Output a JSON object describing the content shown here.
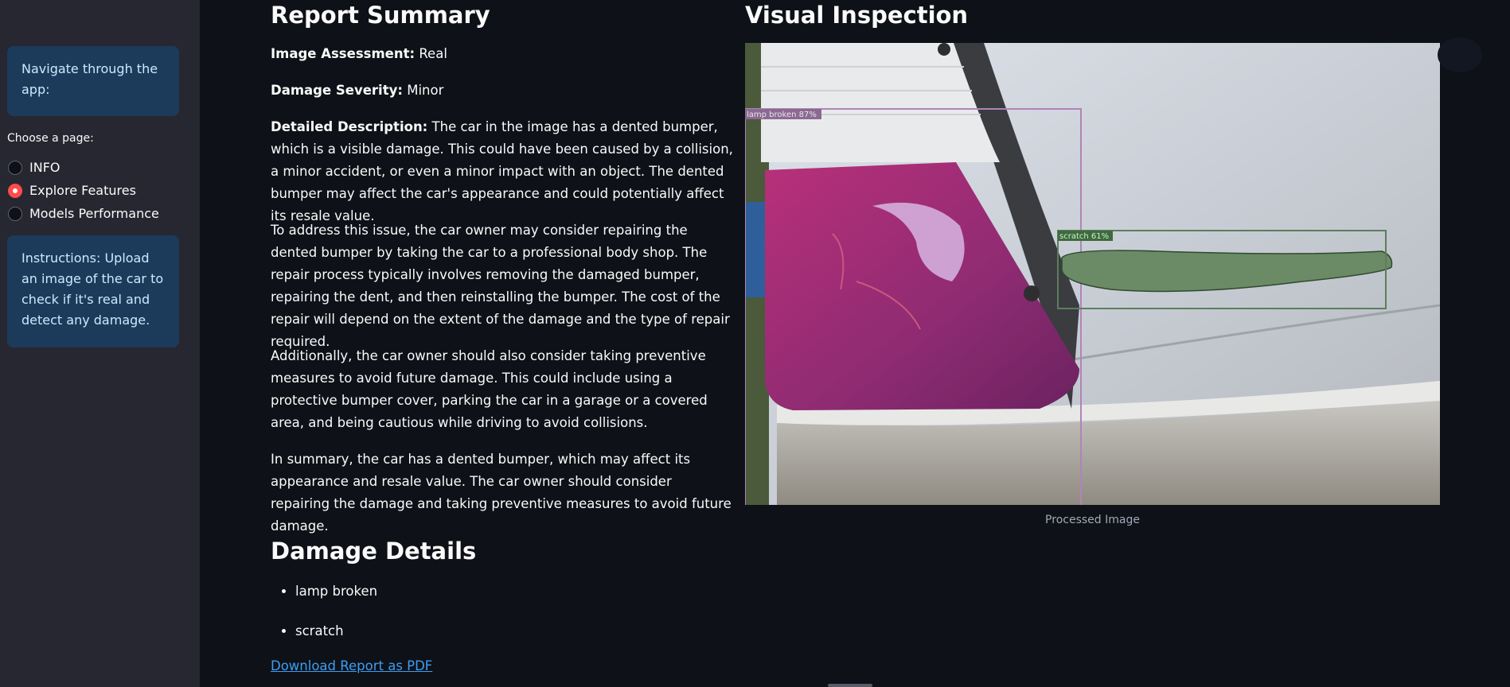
{
  "sidebar": {
    "nav_text": "Navigate through the app:",
    "choose_label": "Choose a page:",
    "pages": [
      {
        "label": "INFO",
        "selected": false
      },
      {
        "label": "Explore Features",
        "selected": true
      },
      {
        "label": "Models Performance",
        "selected": false
      }
    ],
    "instructions": "Instructions: Upload an image of the car to check if it's real and detect any damage."
  },
  "report": {
    "title": "Report Summary",
    "assessment_label": "Image Assessment:",
    "assessment_value": "Real",
    "severity_label": "Damage Severity:",
    "severity_value": "Minor",
    "description_label": "Detailed Description:",
    "paragraphs": [
      "The car in the image has a dented bumper, which is a visible damage. This could have been caused by a collision, a minor accident, or even a minor impact with an object. The dented bumper may affect the car's appearance and could potentially affect its resale value.",
      "To address this issue, the car owner may consider repairing the dented bumper by taking the car to a professional body shop. The repair process typically involves removing the damaged bumper, repairing the dent, and then reinstalling the bumper. The cost of the repair will depend on the extent of the damage and the type of repair required.",
      "Additionally, the car owner should also consider taking preventive measures to avoid future damage. This could include using a protective bumper cover, parking the car in a garage or a covered area, and being cautious while driving to avoid collisions.",
      "In summary, the car has a dented bumper, which may affect its appearance and resale value. The car owner should consider repairing the damage and taking preventive measures to avoid future damage."
    ],
    "details_title": "Damage Details",
    "damage_items": [
      "lamp broken",
      "scratch"
    ],
    "download_label": "Download Report as PDF"
  },
  "visual": {
    "title": "Visual Inspection",
    "detections": [
      {
        "label": "lamp broken 87%",
        "color": "#b084b8"
      },
      {
        "label": "scratch 61%",
        "color": "#5d7d5d"
      }
    ],
    "caption": "Processed Image"
  },
  "colors": {
    "background": "#0e1117",
    "sidebar": "#262730",
    "info_box": "#1c3b5a",
    "radio_selected": "#ff4b4b",
    "link": "#3d9df3"
  }
}
